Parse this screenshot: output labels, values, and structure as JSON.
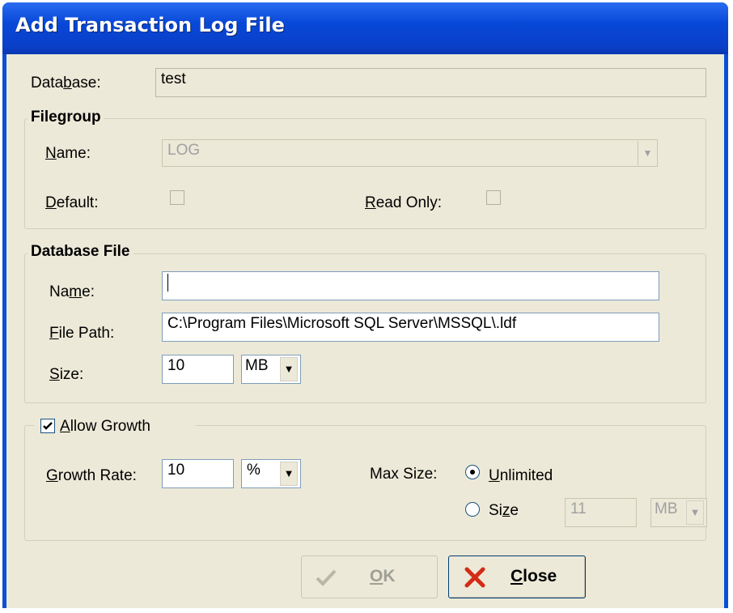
{
  "window": {
    "title": "Add Transaction Log File"
  },
  "database": {
    "label_pre": "Data",
    "label_accel": "b",
    "label_post": "ase:",
    "value": "test"
  },
  "filegroup": {
    "title": "Filegroup",
    "name_label_accel": "N",
    "name_label_post": "ame:",
    "name_value": "LOG",
    "default_label_accel": "D",
    "default_label_post": "efault:",
    "default_checked": false,
    "readonly_label_accel": "R",
    "readonly_label_post": "ead Only:",
    "readonly_checked": false
  },
  "database_file": {
    "title": "Database File",
    "name_label_pre": "Na",
    "name_label_accel": "m",
    "name_label_post": "e:",
    "name_value": "",
    "path_label_accel": "F",
    "path_label_post": "ile Path:",
    "path_value": "C:\\Program Files\\Microsoft SQL Server\\MSSQL\\.ldf",
    "size_label_accel": "S",
    "size_label_post": "ize:",
    "size_value": "10",
    "size_unit": "MB"
  },
  "growth": {
    "allow_label_accel": "A",
    "allow_label_post": "llow Growth",
    "allow_checked": true,
    "rate_label_accel": "G",
    "rate_label_post": "rowth Rate:",
    "rate_value": "10",
    "rate_unit": "%",
    "max_size_label": "Max Size:",
    "unlimited_label_accel": "U",
    "unlimited_label_post": "nlimited",
    "unlimited_selected": true,
    "size_label_pre": "Si",
    "size_label_accel": "z",
    "size_label_post": "e",
    "size_selected": false,
    "max_size_value": "11",
    "max_size_unit": "MB"
  },
  "buttons": {
    "ok_label_accel": "O",
    "ok_label_post": "K",
    "ok_enabled": false,
    "close_label_accel": "C",
    "close_label_post": "lose"
  },
  "icons": {
    "ok": "checkmark-icon",
    "close": "red-x-icon"
  }
}
